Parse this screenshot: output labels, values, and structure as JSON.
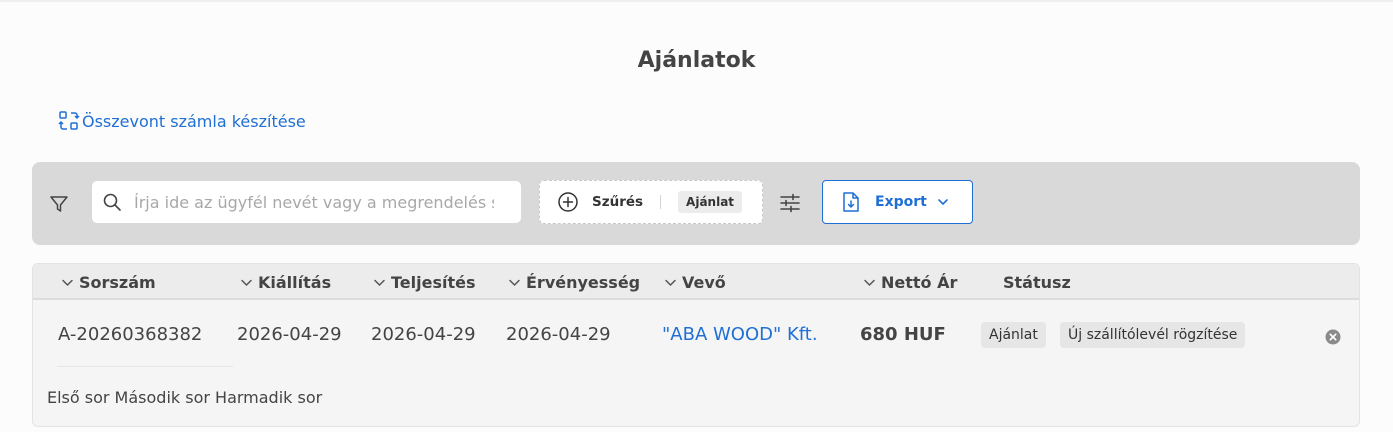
{
  "page": {
    "title": "Ajánlatok"
  },
  "actions": {
    "merge_invoice": "Összevont számla készítése"
  },
  "toolbar": {
    "search_placeholder": "Írja ide az ügyfél nevét vagy a megrendelés s",
    "search_value": "",
    "filter_label": "Szűrés",
    "filter_chip": "Ajánlat",
    "export_label": "Export"
  },
  "table": {
    "columns": [
      "Sorszám",
      "Kiállítás",
      "Teljesítés",
      "Érvényesség",
      "Vevő",
      "Nettó Ár",
      "Státusz"
    ],
    "rows": [
      {
        "number": "A-20260368382",
        "issued": "2026-04-29",
        "completed": "2026-04-29",
        "valid_until": "2026-04-29",
        "customer": "\"ABA WOOD\" Kft.",
        "net_price": "680 HUF",
        "status": "Ajánlat",
        "action": "Új szállítólevél rögzítése",
        "note": "Első sor Második sor Harmadik sor"
      }
    ]
  },
  "colors": {
    "accent": "#1f6fd4",
    "toolbar_bg": "#d9d9d9",
    "badge_bg": "#e6e6e6"
  },
  "icons": {
    "merge": "merge-invoice-icon",
    "filter": "funnel-icon",
    "search": "search-icon",
    "add": "plus-circle-icon",
    "settings": "sliders-icon",
    "export": "file-download-icon",
    "dropdown": "chevron-down-icon",
    "remove": "close-circle-icon"
  }
}
